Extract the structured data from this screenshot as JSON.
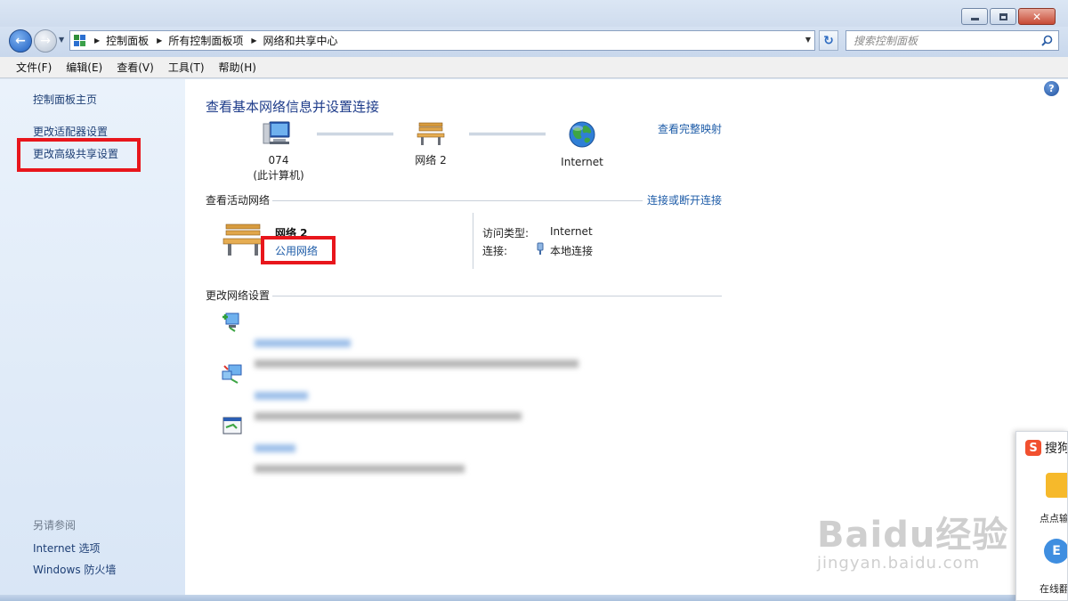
{
  "address_bar": {
    "breadcrumbs": [
      "控制面板",
      "所有控制面板项",
      "网络和共享中心"
    ]
  },
  "search": {
    "placeholder": "搜索控制面板"
  },
  "menu": [
    "文件(F)",
    "编辑(E)",
    "查看(V)",
    "工具(T)",
    "帮助(H)"
  ],
  "sidebar": {
    "items": [
      "控制面板主页",
      "更改适配器设置",
      "更改高级共享设置"
    ],
    "see_also_heading": "另请参阅",
    "see_also": [
      "Internet 选项",
      "Windows 防火墙"
    ]
  },
  "main": {
    "heading": "查看基本网络信息并设置连接",
    "full_map_link": "查看完整映射",
    "map_nodes": [
      {
        "line1": "074",
        "line2": "(此计算机)",
        "icon": "computer-icon"
      },
      {
        "line1": "网络  2",
        "icon": "bench-icon"
      },
      {
        "line1": "Internet",
        "icon": "globe-icon"
      }
    ],
    "active_section": {
      "heading": "查看活动网络",
      "connect_link": "连接或断开连接",
      "network_name": "网络  2",
      "network_type": "公用网络",
      "access_type_label": "访问类型:",
      "access_type_value": "Internet",
      "connection_label": "连接:",
      "connection_value": "本地连接"
    },
    "change_section": {
      "heading": "更改网络设置"
    }
  },
  "sogou": {
    "title": "搜狗",
    "item1": "点点输",
    "item2": "在线翻"
  },
  "watermark": {
    "big": "Baidu经验",
    "small": "jingyan.baidu.com"
  },
  "colors": {
    "accent": "#1e5ca8",
    "highlight": "#e8161c"
  }
}
